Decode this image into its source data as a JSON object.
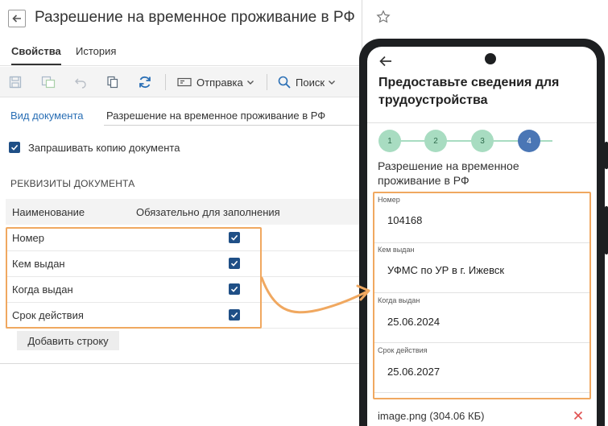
{
  "header": {
    "title": "Разрешение на временное проживание в РФ"
  },
  "tabs": [
    {
      "label": "Свойства",
      "active": true
    },
    {
      "label": "История",
      "active": false
    }
  ],
  "toolbar": {
    "send_label": "Отправка",
    "search_label": "Поиск"
  },
  "form": {
    "doc_kind_label": "Вид документа",
    "doc_kind_value": "Разрешение на временное проживание в РФ",
    "request_copy_label": "Запрашивать копию документа",
    "request_copy_checked": true
  },
  "requisites": {
    "section_title": "РЕКВИЗИТЫ ДОКУМЕНТА",
    "columns": [
      "Наименование",
      "Обязательно для заполнения"
    ],
    "rows": [
      {
        "name": "Номер",
        "required": true
      },
      {
        "name": "Кем выдан",
        "required": true
      },
      {
        "name": "Когда выдан",
        "required": true
      },
      {
        "name": "Срок действия",
        "required": true
      }
    ],
    "add_row_label": "Добавить строку"
  },
  "phone": {
    "title": "Предоставьте сведения для трудоустройства",
    "steps": [
      "1",
      "2",
      "3",
      "4"
    ],
    "current_step": 4,
    "doc_title": "Разрешение на временное проживание в РФ",
    "fields": [
      {
        "label": "Номер",
        "value": "104168"
      },
      {
        "label": "Кем выдан",
        "value": "УФМС по УР в г. Ижевск"
      },
      {
        "label": "Когда выдан",
        "value": "25.06.2024"
      },
      {
        "label": "Срок действия",
        "value": "25.06.2027"
      }
    ],
    "attachment": "image.png (304.06 КБ)"
  },
  "colors": {
    "accent_link": "#2a6fb5",
    "checkbox": "#1f4f86",
    "highlight": "#f0a860",
    "step_done": "#a8dcc1",
    "step_current": "#4a76b5",
    "delete": "#e05050"
  }
}
